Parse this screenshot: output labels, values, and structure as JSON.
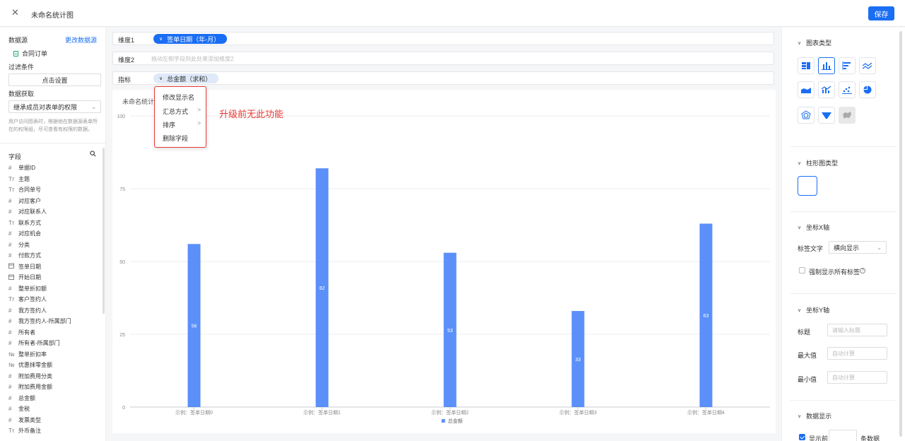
{
  "header": {
    "close_glyph": "✕",
    "title": "未命名统计图",
    "save_label": "保存"
  },
  "left_panel": {
    "datasource_label": "数据源",
    "change_datasource": "更改数据源",
    "datasource_name": "合同订单",
    "filter_label": "过滤条件",
    "filter_button": "点击设置",
    "fetch_label": "数据获取",
    "fetch_value": "继承成员对表单的权限",
    "fetch_hint": "用户访问图表时，根据他在数据源表单所在的权限组，尽可查看有权限的数据。",
    "fields_label": "字段",
    "fields": [
      {
        "icon": "#",
        "name": "单据ID"
      },
      {
        "icon": "Tт",
        "name": "主题"
      },
      {
        "icon": "Tт",
        "name": "合同单号"
      },
      {
        "icon": "#",
        "name": "对应客户"
      },
      {
        "icon": "#",
        "name": "对应联系人"
      },
      {
        "icon": "Tт",
        "name": "联系方式"
      },
      {
        "icon": "#",
        "name": "对应机会"
      },
      {
        "icon": "#",
        "name": "分类"
      },
      {
        "icon": "#",
        "name": "付款方式"
      },
      {
        "icon": "cal",
        "name": "签单日期"
      },
      {
        "icon": "cal",
        "name": "开始日期"
      },
      {
        "icon": "#",
        "name": "整单折扣额"
      },
      {
        "icon": "Tт",
        "name": "客户签约人"
      },
      {
        "icon": "#",
        "name": "我方签约人"
      },
      {
        "icon": "#",
        "name": "我方签约人-所属部门"
      },
      {
        "icon": "#",
        "name": "所有者"
      },
      {
        "icon": "#",
        "name": "所有者-所属部门"
      },
      {
        "icon": "№",
        "name": "整单折扣率"
      },
      {
        "icon": "№",
        "name": "优惠抹零金额"
      },
      {
        "icon": "#",
        "name": "附加费用分类"
      },
      {
        "icon": "#",
        "name": "附加费用金额"
      },
      {
        "icon": "#",
        "name": "总金额"
      },
      {
        "icon": "#",
        "name": "金税"
      },
      {
        "icon": "#",
        "name": "发票类型"
      },
      {
        "icon": "Tт",
        "name": "外币备注"
      }
    ]
  },
  "shelves": {
    "dim1_label": "维度1",
    "dim1_pill": "签单日期（年-月）",
    "dim2_label": "维度2",
    "dim2_placeholder": "拖动左侧字段到此处来添加维度2",
    "measure_label": "指标",
    "measure_pill": "总金额（求和）"
  },
  "context_menu": {
    "items": [
      "修改显示名",
      "汇总方式",
      "排序",
      "删除字段"
    ],
    "arrow": ">"
  },
  "annotation_text": "升级前无此功能",
  "chart_data": {
    "type": "bar",
    "title": "未命名统计图",
    "categories": [
      "示例：签单日期0",
      "示例：签单日期1",
      "示例：签单日期2",
      "示例：签单日期3",
      "示例：签单日期4"
    ],
    "series": [
      {
        "name": "总金额",
        "values": [
          56,
          82,
          53,
          33,
          63
        ]
      }
    ],
    "y_ticks": [
      0,
      25,
      50,
      75,
      100
    ],
    "ylim": [
      0,
      100
    ],
    "grid": true,
    "legend": "bottom-center",
    "color": "#5b8ff9"
  },
  "right_panel": {
    "chart_type_label": "图表类型",
    "bar_type_label": "柱形图类型",
    "xaxis_label": "坐标X轴",
    "label_text_label": "标签文字",
    "label_text_value": "横向显示",
    "force_all_labels": "强制显示所有标签",
    "help_glyph": "?",
    "yaxis_label": "坐标Y轴",
    "title_label": "标题",
    "title_placeholder": "请输入标题",
    "max_label": "最大值",
    "max_placeholder": "自动计算",
    "min_label": "最小值",
    "min_placeholder": "自动计算",
    "data_display_label": "数据显示",
    "show_top_label": "显示前",
    "rows_label": "条数据"
  },
  "colors": {
    "accent": "#1a6ef4",
    "bar": "#5b8ff9",
    "annotation": "#e53935"
  }
}
